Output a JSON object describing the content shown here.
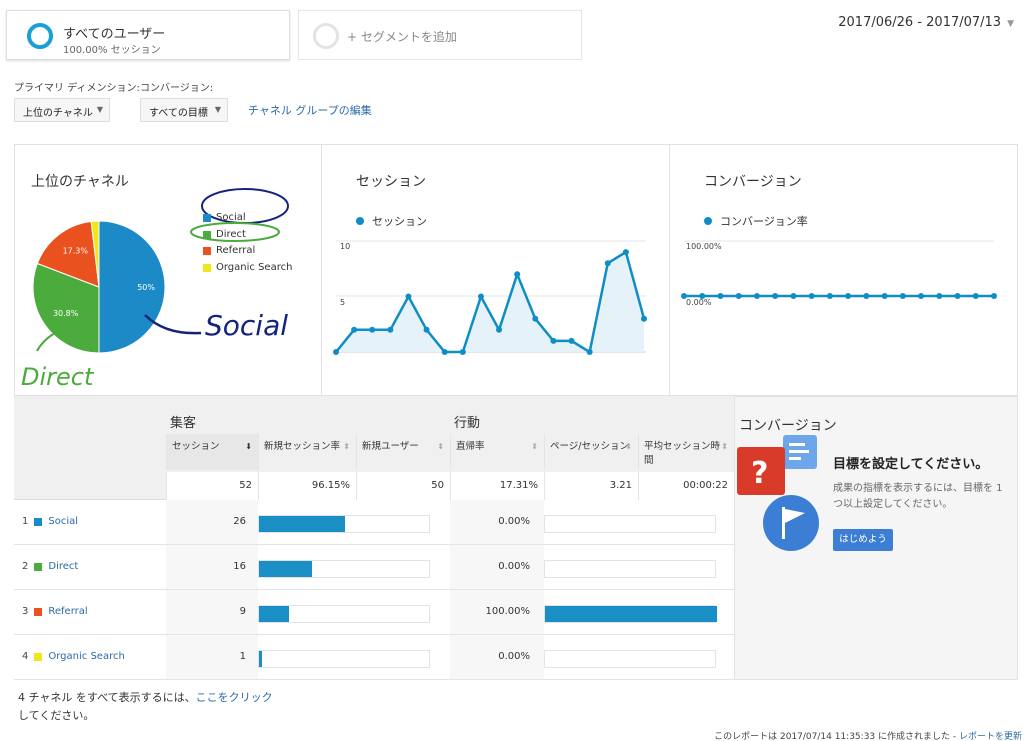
{
  "segments": {
    "active": {
      "title": "すべてのユーザー",
      "subtitle": "100.00% セッション"
    },
    "add_label": "+ セグメントを追加"
  },
  "date_range": "2017/06/26 - 2017/07/13",
  "dimensions": {
    "primary_label": "プライマリ ディメンション:",
    "conversion_label": "コンバージョン:",
    "primary_value": "上位のチャネル",
    "conversion_value": "すべての目標",
    "edit_link": "チャネル グループの編集"
  },
  "colors": {
    "social": "#1b8ac7",
    "direct": "#4bab3d",
    "referral": "#e9521f",
    "organic": "#f0e61c",
    "line": "#0f8dc4"
  },
  "chart_data": [
    {
      "type": "pie",
      "title": "上位のチャネル",
      "categories": [
        "Social",
        "Direct",
        "Referral",
        "Organic Search"
      ],
      "values": [
        50,
        30.8,
        17.3,
        1.9
      ],
      "labels": [
        "50%",
        "30.8%",
        "17.3%",
        ""
      ]
    },
    {
      "type": "area",
      "title": "セッション",
      "series": [
        {
          "name": "セッション",
          "values": [
            0,
            2,
            2,
            2,
            5,
            2,
            0,
            0,
            5,
            2,
            7,
            3,
            1,
            1,
            0,
            8,
            9,
            3
          ]
        }
      ],
      "yticks": [
        "10",
        "5"
      ],
      "ylim": [
        0,
        10
      ]
    },
    {
      "type": "line",
      "title": "コンバージョン",
      "series": [
        {
          "name": "コンバージョン率",
          "values": [
            0,
            0,
            0,
            0,
            0,
            0,
            0,
            0,
            0,
            0,
            0,
            0,
            0,
            0,
            0,
            0,
            0,
            0
          ]
        }
      ],
      "yticks": [
        "100.00%",
        "0.00%"
      ],
      "ylim": [
        0,
        100
      ]
    }
  ],
  "table": {
    "groups": {
      "acquisition": "集客",
      "behavior": "行動",
      "conversion": "コンバージョン"
    },
    "columns": {
      "sessions": "セッション",
      "new_session_rate": "新規セッション率",
      "new_users": "新規ユーザー",
      "bounce_rate": "直帰率",
      "pages_per_session": "ページ/セッション",
      "avg_session_time": "平均セッション時間"
    },
    "totals": {
      "sessions": "52",
      "new_session_rate": "96.15%",
      "new_users": "50",
      "bounce_rate": "17.31%",
      "pages_per_session": "3.21",
      "avg_session_time": "00:00:22"
    },
    "rows": [
      {
        "num": "1",
        "name": "Social",
        "sessions": "26",
        "new_share": 0.5,
        "bounce": "0.00%",
        "bounce_share": 0
      },
      {
        "num": "2",
        "name": "Direct",
        "sessions": "16",
        "new_share": 0.308,
        "bounce": "0.00%",
        "bounce_share": 0
      },
      {
        "num": "3",
        "name": "Referral",
        "sessions": "9",
        "new_share": 0.173,
        "bounce": "100.00%",
        "bounce_share": 1
      },
      {
        "num": "4",
        "name": "Organic Search",
        "sessions": "1",
        "new_share": 0.019,
        "bounce": "0.00%",
        "bounce_share": 0
      }
    ]
  },
  "goal_box": {
    "title": "目標を設定してください。",
    "text": "成果の指標を表示するには、目標を 1 つ以上設定してください。",
    "button": "はじめよう"
  },
  "footer": {
    "prefix": "4 チャネル をすべて表示するには、",
    "link": "ここをクリック",
    "suffix": "してください。",
    "report_note": "このレポートは 2017/07/14 11:35:33 に作成されました - ",
    "report_link": "レポートを更新"
  },
  "annotations": {
    "social": "Social",
    "direct": "Direct"
  }
}
